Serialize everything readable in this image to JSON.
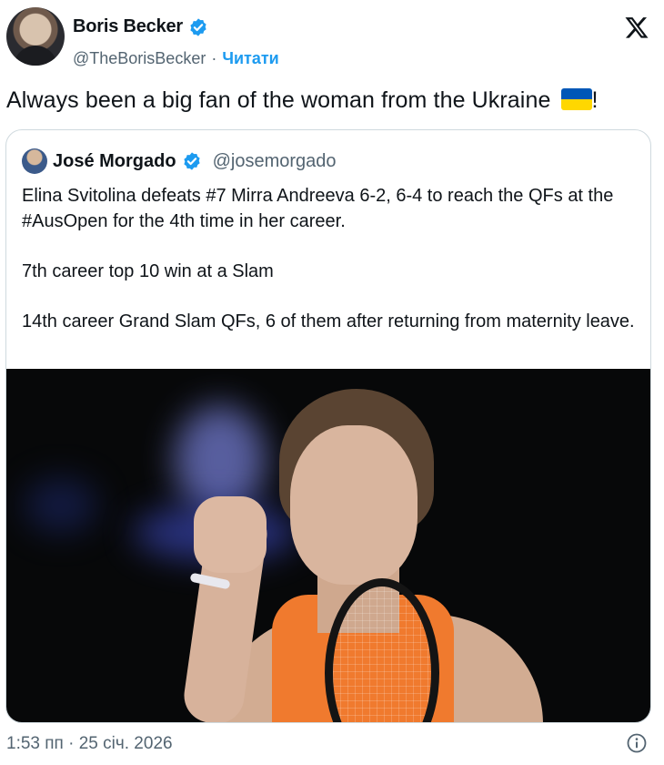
{
  "author": {
    "display_name": "Boris Becker",
    "handle": "@TheBorisBecker",
    "separator": "·",
    "follow_label": "Читати"
  },
  "tweet": {
    "text": "Always been a big fan of the woman from the Ukraine",
    "emoji_name": "ukraine-flag-icon",
    "text_end": "!"
  },
  "quoted": {
    "display_name": "José Morgado",
    "handle": "@josemorgado",
    "paragraphs": [
      "Elina Svitolina defeats #7 Mirra Andreeva 6-2, 6-4 to reach the QFs at the #AusOpen for the 4th time in her career.",
      "7th career top 10 win at a Slam",
      "14th career Grand Slam QFs, 6 of them after returning from maternity leave."
    ]
  },
  "footer": {
    "timestamp": "1:53 пп · 25 січ. 2026"
  },
  "colors": {
    "accent": "#1d9bf0",
    "secondary_text": "#536471",
    "border": "#cfd9de",
    "flag_blue": "#0057b7",
    "flag_yellow": "#ffd700"
  }
}
